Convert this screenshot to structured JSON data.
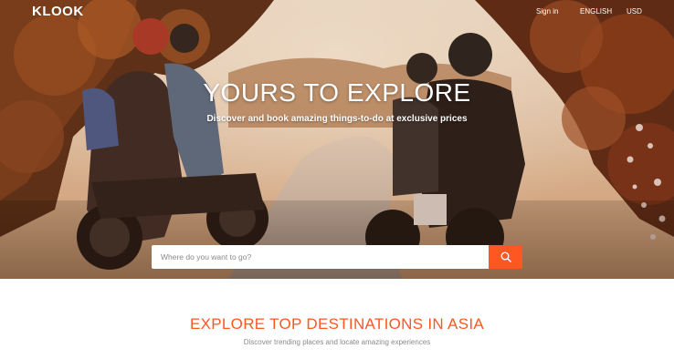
{
  "header": {
    "logo_text": "KLOOK",
    "sign_in": "Sign in",
    "language": "ENGLISH",
    "currency": "USD"
  },
  "hero": {
    "title": "YOURS TO EXPLORE",
    "subtitle": "Discover and book amazing things-to-do at exclusive prices",
    "search_placeholder": "Where do you want to go?",
    "search_icon": "search-icon"
  },
  "section": {
    "title": "EXPLORE TOP DESTINATIONS IN ASIA",
    "subtitle": "Discover trending places and locate amazing experiences"
  },
  "colors": {
    "accent": "#ff5722",
    "text_white": "#ffffff",
    "muted": "#8a8a8a"
  }
}
